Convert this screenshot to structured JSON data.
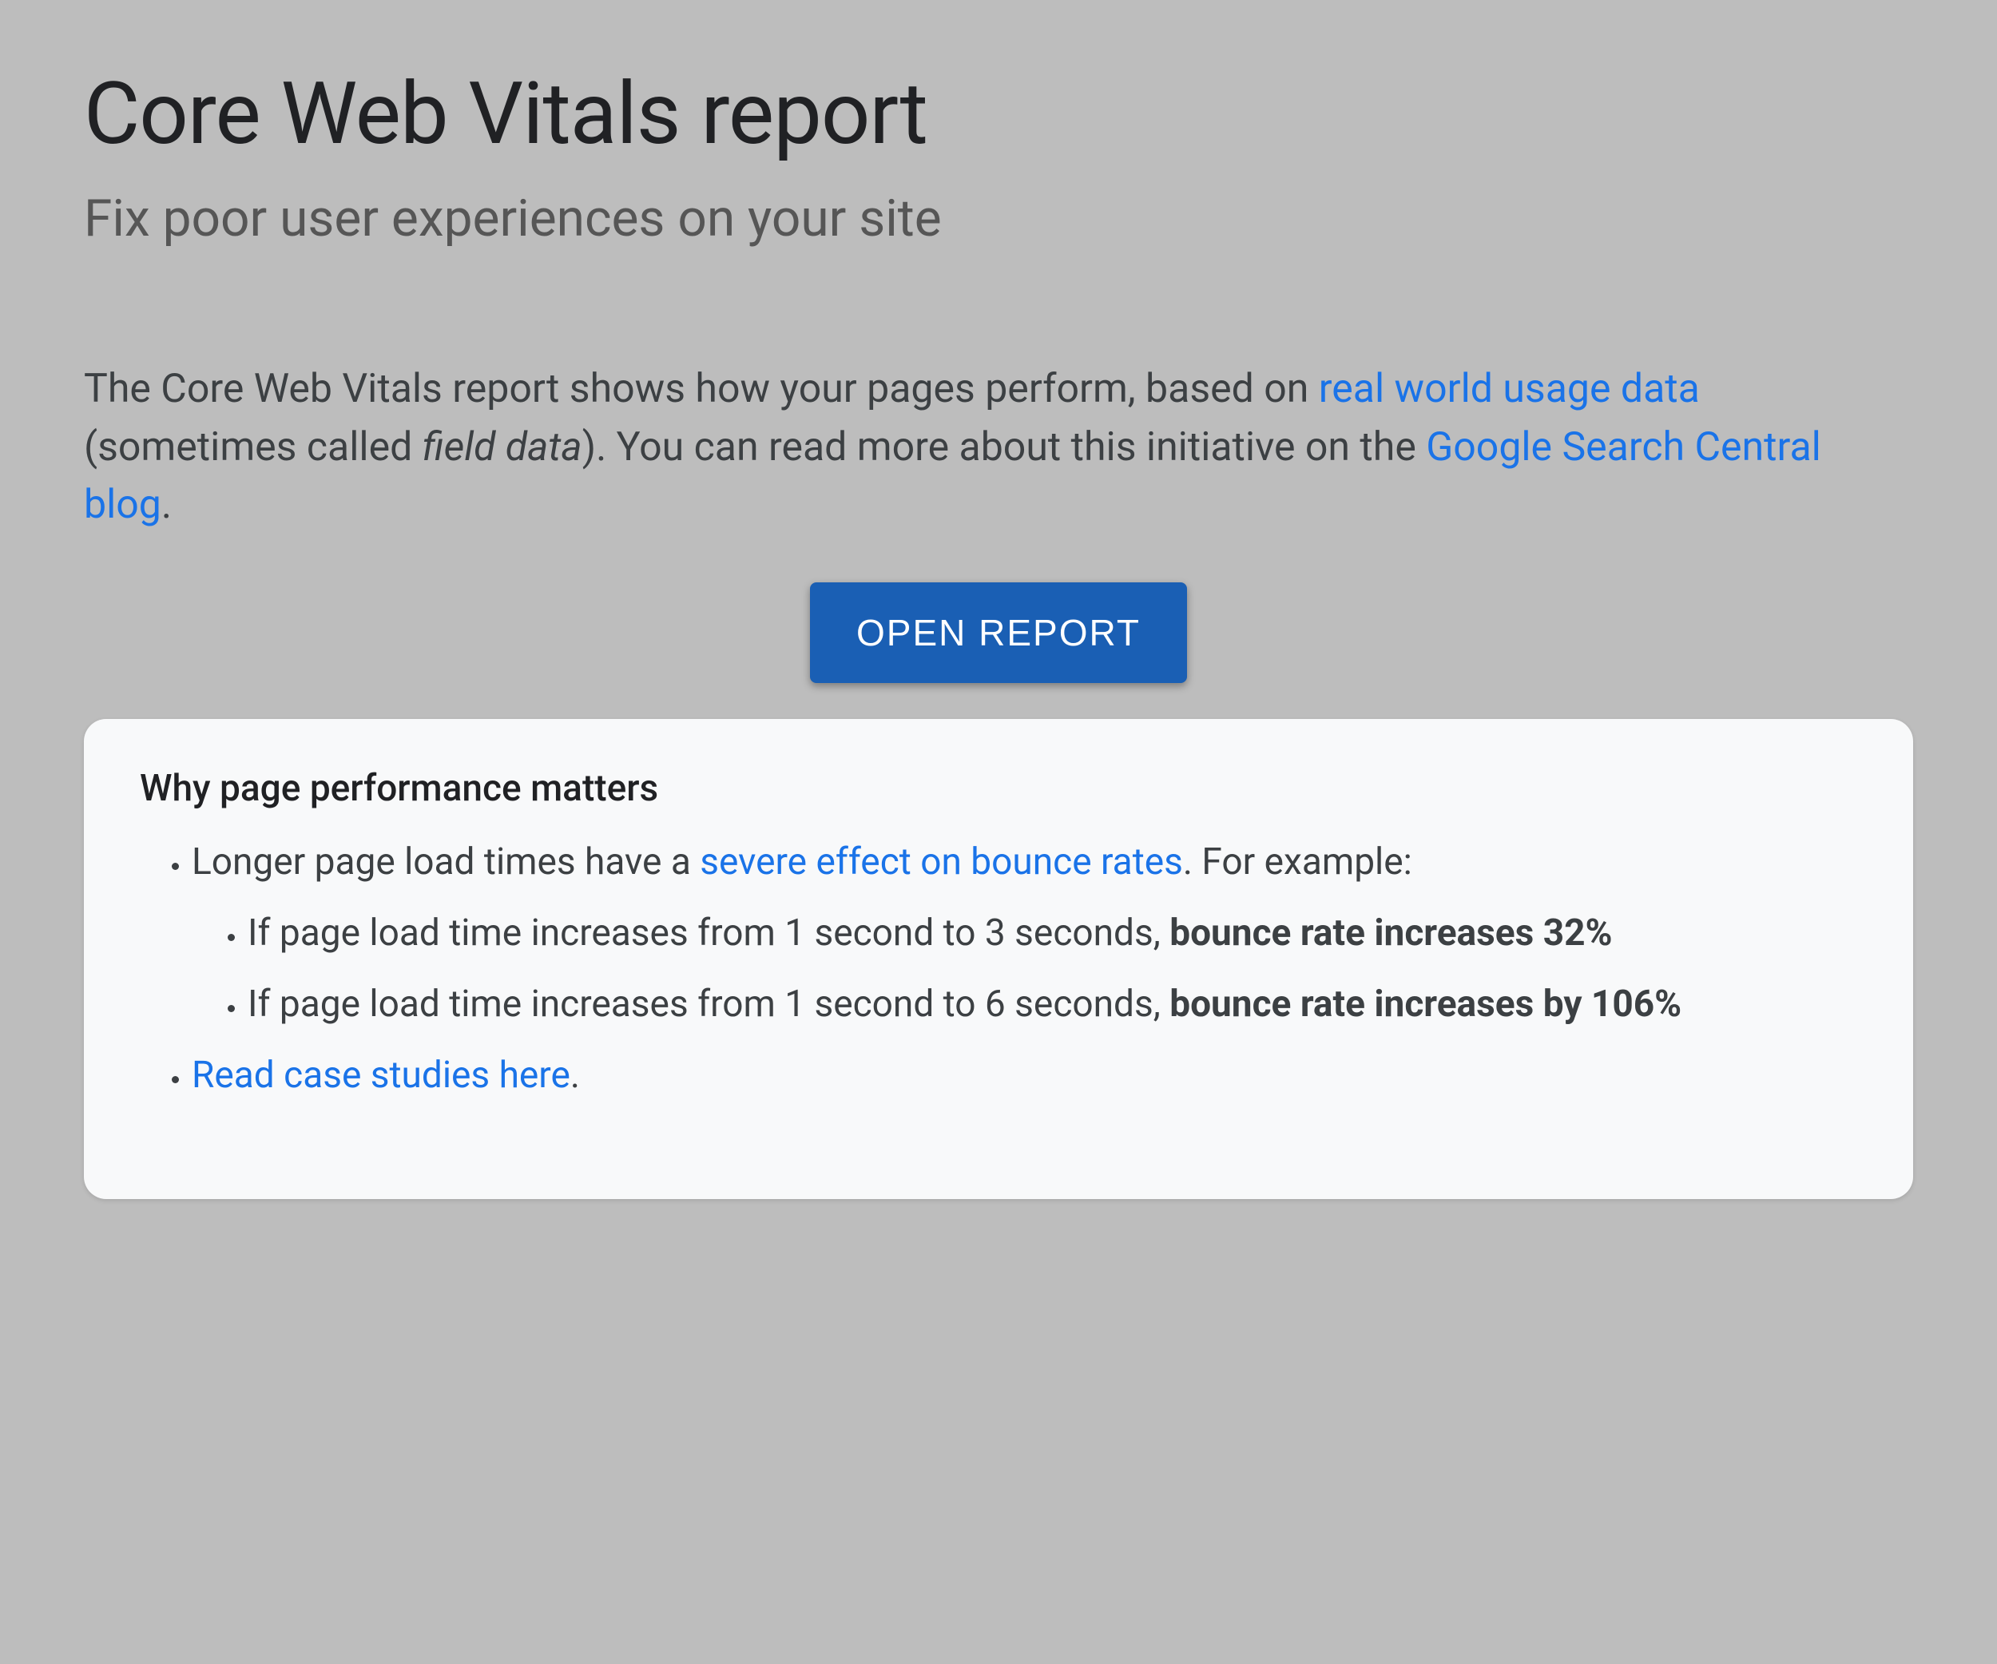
{
  "header": {
    "title": "Core Web Vitals report",
    "subtitle": "Fix poor user experiences on your site"
  },
  "intro": {
    "pre": "The Core Web Vitals report shows how your pages perform, based on ",
    "link1": "real world usage data",
    "mid1": " (sometimes called ",
    "italic": "field data",
    "mid2": "). You can read more about this initiative on the ",
    "link2": "Google Search Central blog",
    "post": "."
  },
  "actions": {
    "open_report": "OPEN REPORT"
  },
  "card": {
    "heading": "Why page performance matters",
    "bullet1_pre": "Longer page load times have a ",
    "bullet1_link": "severe effect on bounce rates",
    "bullet1_post": ". For example:",
    "sub1_pre": "If page load time increases from 1 second to 3 seconds, ",
    "sub1_bold": "bounce rate increases 32%",
    "sub2_pre": "If page load time increases from 1 second to 6 seconds, ",
    "sub2_bold": "bounce rate increases by 106%",
    "bullet2_link": "Read case studies here",
    "bullet2_post": "."
  }
}
